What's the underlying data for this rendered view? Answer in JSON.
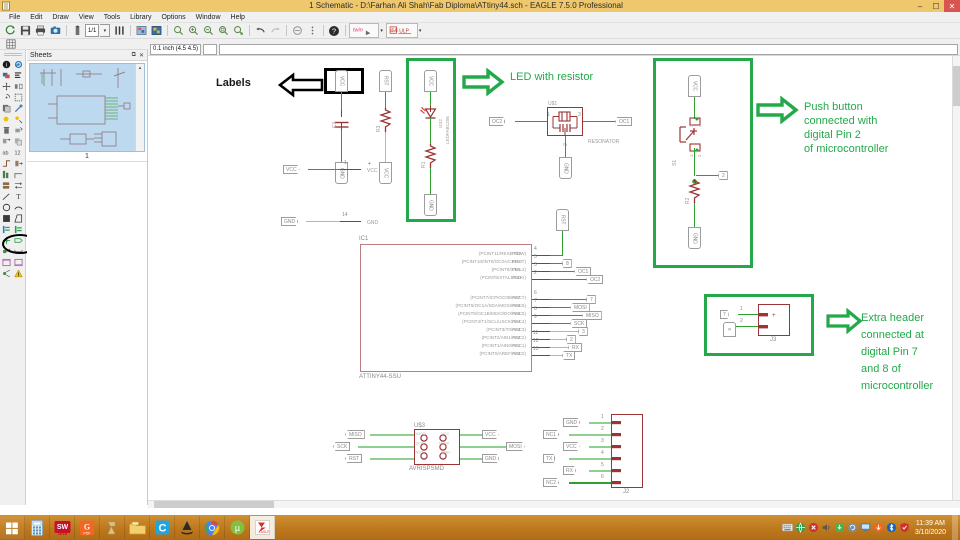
{
  "window": {
    "title": "1 Schematic - D:\\Farhan Ali Shah\\Fab Diploma\\ATtiny44.sch - EAGLE 7.5.0 Professional",
    "app_icon": "schematic-icon",
    "minimize_label": "–",
    "maximize_label": "☐",
    "close_label": "✕",
    "titlebar_color": "#efc76c"
  },
  "menu": {
    "items": [
      "File",
      "Edit",
      "Draw",
      "View",
      "Tools",
      "Library",
      "Options",
      "Window",
      "Help"
    ]
  },
  "toolbar": {
    "sheet_selector_value": "1/1",
    "sheet_selector_arrow": "▾",
    "script_caret_1": "▾",
    "script_caret_2": "▾",
    "buttons": [
      {
        "name": "refresh-icon",
        "glyph": "↻"
      },
      {
        "name": "save-icon",
        "glyph": "💾"
      },
      {
        "name": "print-icon",
        "glyph": "⎙"
      },
      {
        "name": "camera-icon",
        "glyph": "📷"
      },
      {
        "name": "sheet-icon",
        "glyph": "▤"
      },
      {
        "name": "grid-icon",
        "glyph": "❙❙❙"
      },
      {
        "name": "display-layers-icon",
        "glyph": "▨"
      },
      {
        "name": "board-icon",
        "glyph": "▩"
      },
      {
        "name": "zoom-fit-icon",
        "glyph": "⌕"
      },
      {
        "name": "zoom-in-icon",
        "glyph": "⌕"
      },
      {
        "name": "zoom-out-icon",
        "glyph": "⌕"
      },
      {
        "name": "zoom-redraw-icon",
        "glyph": "⌕"
      },
      {
        "name": "zoom-select-icon",
        "glyph": "⌕"
      },
      {
        "name": "undo-icon",
        "glyph": "↶"
      },
      {
        "name": "redo-icon",
        "glyph": "↷"
      },
      {
        "name": "stop-icon",
        "glyph": "⊖"
      },
      {
        "name": "run-script-icon",
        "glyph": "⋮"
      },
      {
        "name": "help-icon",
        "glyph": "?"
      }
    ]
  },
  "coordbar": {
    "grid_value": "0.1 inch (4.5 4.5)",
    "command_value": ""
  },
  "sheets_panel": {
    "title": "Sheets",
    "undock_label": "⧉",
    "close_label": "✕",
    "sheet_number": "1",
    "scroll_up": "▴"
  },
  "palette": {
    "rows": [
      [
        "info-icon",
        "reload-icon"
      ],
      [
        "layer-icon",
        "display-icon"
      ],
      [
        "move-icon",
        "mirror-icon"
      ],
      [
        "rotate-icon",
        "group-icon"
      ],
      [
        "paste-icon",
        "wrench-icon"
      ],
      [
        "dot-icon",
        "smash-icon"
      ],
      [
        "delete-icon",
        "add-part-icon"
      ],
      [
        "replace-icon",
        "copy-icon"
      ],
      [
        "name-icon",
        "value-icon"
      ],
      [
        "split-icon",
        "invoke-icon"
      ],
      [
        "optimize-icon",
        "miter-icon"
      ],
      [
        "array-icon",
        "pinswap-icon"
      ],
      [
        "line-icon",
        "text-icon"
      ],
      [
        "circle-icon",
        "arc-icon"
      ],
      [
        "rect-icon",
        "polygon-icon"
      ],
      [
        "bus-icon",
        "net-icon"
      ],
      [
        "junction-icon",
        "label-icon"
      ],
      [
        "attribute-icon",
        "dimension-icon"
      ],
      [
        "frame-icon",
        "sheet-icon"
      ],
      [
        "erc-icon",
        "warning-icon"
      ]
    ],
    "highlight_annotation": "ellipse-highlight"
  },
  "annotations": {
    "labels_text": "Labels",
    "led_text": "LED with resistor",
    "push_button_lines": [
      "Push button",
      "connected with",
      "digital Pin 2",
      "of microcontroller"
    ],
    "extra_header_lines": [
      "Extra header",
      "connected at",
      "digital Pin 7",
      "and 8 of",
      "microcontroller"
    ],
    "accent_green": "#23a94a",
    "arrow_black_name": "black-arrow-left",
    "arrow_green_1_name": "green-arrow-right-led",
    "arrow_green_2_name": "green-arrow-right-button",
    "arrow_green_3_name": "green-arrow-right-header"
  },
  "schematic": {
    "ic": {
      "refdes": "IC1",
      "value": "ATTINY44-SSU",
      "vcc_label": "VCC",
      "gnd_label": "GND",
      "plus_label": "+",
      "vcc_pin": "1",
      "gnd_pin": "14",
      "pins_right": [
        {
          "func": "(PCINT11/RESET/DW)",
          "name": "PB3",
          "num": "4",
          "net": ""
        },
        {
          "func": "(PCINT10/INT0/OC0A/CKOUT)",
          "name": "PB2",
          "num": "5",
          "net": "8"
        },
        {
          "func": "(PCINT9/XTAL2)",
          "name": "PB1",
          "num": "3",
          "net": "OC1"
        },
        {
          "func": "(PCINT8/XTAL1/CLKI)",
          "name": "PB0",
          "num": "2",
          "net": "OC2"
        },
        {
          "func": "(PCINT7/ICP/OC0B/ADC7)",
          "name": "PA7",
          "num": "6",
          "net": "7"
        },
        {
          "func": "(PCINT6/OC1A/SDA/MOSI/ADC6)",
          "name": "PA6",
          "num": "7",
          "net": "MOSI"
        },
        {
          "func": "(PCINT5/OC1B/MISO/DO/ADC5)",
          "name": "PA5",
          "num": "8",
          "net": "MISO"
        },
        {
          "func": "(PCINT4/T1/SCL/USCK/ADC4)",
          "name": "PA4",
          "num": "9",
          "net": "SCK"
        },
        {
          "func": "(PCINT3/T0/ADC3)",
          "name": "PA3",
          "num": "10",
          "net": "3"
        },
        {
          "func": "(PCINT2/AIN1/ADC2)",
          "name": "PA2",
          "num": "11",
          "net": "2"
        },
        {
          "func": "(PCINT1/AIN0/ADC1)",
          "name": "PA1",
          "num": "12",
          "net": "RX"
        },
        {
          "func": "(PCINT0/AREF/ADC0)",
          "name": "PA0",
          "num": "13",
          "net": "TX"
        }
      ]
    },
    "cap_c1": {
      "refdes": "C1",
      "top_label": "VCC",
      "bottom_label": "GND"
    },
    "res_r3": {
      "refdes": "R3",
      "top_label": "RST",
      "bottom_label": "VCC"
    },
    "led_circuit": {
      "top_label": "VCC",
      "led_refdes": "US2",
      "led_value": "LEDFAB1206",
      "res_refdes": "R1",
      "bottom_label": "GND"
    },
    "resonator": {
      "refdes": "U$1",
      "value": "RESONATOR",
      "left_net": "OC2",
      "right_net": "OC1",
      "gnd_label": "GND",
      "pin_left": "1",
      "pin_right": "3",
      "pin_bottom": "2"
    },
    "button_circuit": {
      "top_label": "VCC",
      "switch_refdes": "S1",
      "switch_pins": [
        "3",
        "4",
        "1",
        "2"
      ],
      "out_net": "2",
      "res_refdes": "R2",
      "bottom_label": "GND"
    },
    "header_j3": {
      "refdes": "J3",
      "pins": [
        "1",
        "2"
      ],
      "nets": [
        "7",
        "8"
      ],
      "plus_label": "+"
    },
    "isp_header": {
      "refdes": "U$3",
      "value": "AVRISPSMD",
      "left_nets": [
        "MISO",
        "SCK",
        "RST"
      ],
      "right_nets": [
        "VCC",
        "MOSI",
        "GND"
      ],
      "inner_left": [
        "MISO",
        "SCK",
        "RST"
      ],
      "inner_right": [
        "VCC",
        "MOSI",
        "GND"
      ]
    },
    "header_j2": {
      "refdes": "J2",
      "pins": [
        "1",
        "2",
        "3",
        "4",
        "5",
        "6"
      ],
      "nets": [
        "GND",
        "NC1",
        "VCC",
        "TX",
        "RX",
        "NC2"
      ]
    }
  },
  "taskbar": {
    "items": [
      {
        "name": "start-button",
        "label": "⊞",
        "color": "#ffffff"
      },
      {
        "name": "calculator-app",
        "label": "",
        "color": "#cfe4f5"
      },
      {
        "name": "solidworks-app",
        "label": "SW",
        "color": "#c8102e"
      },
      {
        "name": "pdf-app",
        "label": "G",
        "color": "#f26522"
      },
      {
        "name": "unknown-app",
        "label": "",
        "color": "#e8d6a0"
      },
      {
        "name": "file-explorer-app",
        "label": "",
        "color": "#f5d26a"
      },
      {
        "name": "camtasia-app",
        "label": "C",
        "color": "#1fa6e0"
      },
      {
        "name": "inkscape-app",
        "label": "",
        "color": "#3a3a3a"
      },
      {
        "name": "chrome-app",
        "label": "",
        "color": "#4285f4"
      },
      {
        "name": "utorrent-app",
        "label": "μ",
        "color": "#4caf50"
      },
      {
        "name": "eagle-app",
        "label": "",
        "color": "#d32f2f"
      }
    ],
    "clock_time": "11:39 AM",
    "clock_date": "3/10/2020",
    "tray_icons": [
      "keyboard-icon",
      "network-icon",
      "antivirus-icon",
      "volume-icon",
      "update-icon",
      "sync-icon",
      "monitor-icon",
      "download-icon",
      "bluetooth-icon",
      "shield-icon"
    ]
  }
}
